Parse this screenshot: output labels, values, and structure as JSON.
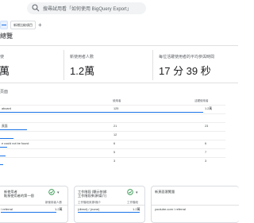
{
  "search": {
    "placeholder": "搜尋試用看「如何使用 BigQuery Export」"
  },
  "chips": [
    {
      "label": "新增比較項目"
    }
  ],
  "page": {
    "title": "總覽"
  },
  "kpis": [
    {
      "label": "使",
      "value": "萬"
    },
    {
      "label": "新使用者人數",
      "value": "1.2萬"
    },
    {
      "label": "每位活躍使用者的平均參與時間",
      "value": "17 分 39 秒"
    }
  ],
  "table": {
    "title": "頁面",
    "headers": [
      "使用者",
      "活躍使用者"
    ],
    "rows": [
      {
        "label": "aboard",
        "c1": "125",
        "c2": "1.2萬",
        "bar": 0.9
      },
      {
        "label": "",
        "c1": "",
        "c2": "",
        "bar": 0
      },
      {
        "label": "頁面",
        "c1": "21",
        "c2": "23",
        "bar": 0.12
      },
      {
        "label": "",
        "c1": "12",
        "c2": "",
        "bar": 0.06
      },
      {
        "label": "e could not be found",
        "c1": "6",
        "c2": "6",
        "bar": 0.03
      },
      {
        "label": "",
        "c1": "5",
        "c2": "7",
        "bar": 0.025
      },
      {
        "label": "",
        "c1": "3",
        "c2": "3",
        "bar": 0.015
      }
    ]
  },
  "cards": [
    {
      "title": "新使用者\n點按使用者的第一個",
      "col_a": "",
      "col_b": "新使用者人數",
      "row_label": "/ referral",
      "row_value": "1.2萬"
    },
    {
      "title": "工作階段 (顯示依據:\n工作階段來源/媒介)",
      "col_a": "工作階段來源/媒介",
      "col_b": "工作階段",
      "row_label": "(direct) / (none)",
      "row_value": "1.2萬"
    },
    {
      "title": "新頁面瀏覽量",
      "col_a": "",
      "col_b": "",
      "row_label": "youtube.com / referral",
      "row_value": ""
    }
  ],
  "colors": {
    "accent": "#1a73e8",
    "success": "#1e8e3e",
    "divider": "#e0e0e0"
  }
}
